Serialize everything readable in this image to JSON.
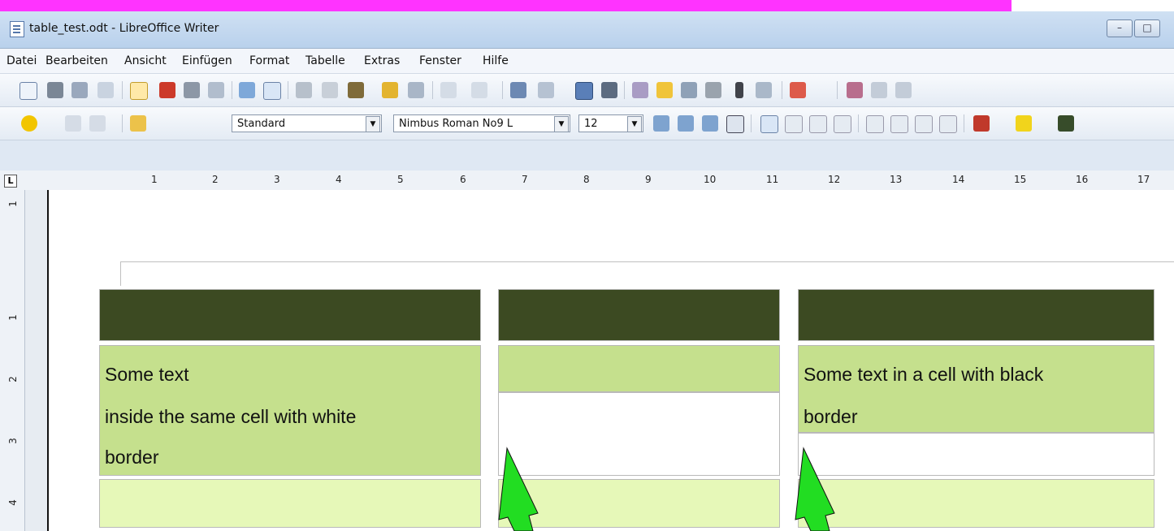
{
  "window": {
    "title": "table_test.odt - LibreOffice Writer",
    "minimize_symbol": "–",
    "maximize_symbol": "□"
  },
  "menu": [
    "Datei",
    "Bearbeiten",
    "Ansicht",
    "Einfügen",
    "Format",
    "Tabelle",
    "Extras",
    "Fenster",
    "Hilfe"
  ],
  "formatting": {
    "paragraph_style": "Standard",
    "font_name": "Nimbus Roman No9 L",
    "font_size": "12"
  },
  "ruler": {
    "h_numbers": [
      "1",
      "2",
      "3",
      "4",
      "5",
      "6",
      "7",
      "8",
      "9",
      "10",
      "11",
      "12",
      "13",
      "14",
      "15",
      "16",
      "17"
    ],
    "v_numbers": [
      "1",
      "1",
      "2",
      "3",
      "4"
    ]
  },
  "table": {
    "header_color": "#3c4a22",
    "row2_color": "#c5e08d",
    "row3_color": "#e6f8b8",
    "cell_1_text_line1": "Some text",
    "cell_1_text_line2": "inside the same cell with white",
    "cell_1_text_line3": "border",
    "cell_3_text_line1": "Some text in a cell with black",
    "cell_3_text_line2": "border"
  },
  "annotations": {
    "arrow_color": "#22dd22"
  },
  "colors": {
    "banner": "#ff33ff"
  }
}
